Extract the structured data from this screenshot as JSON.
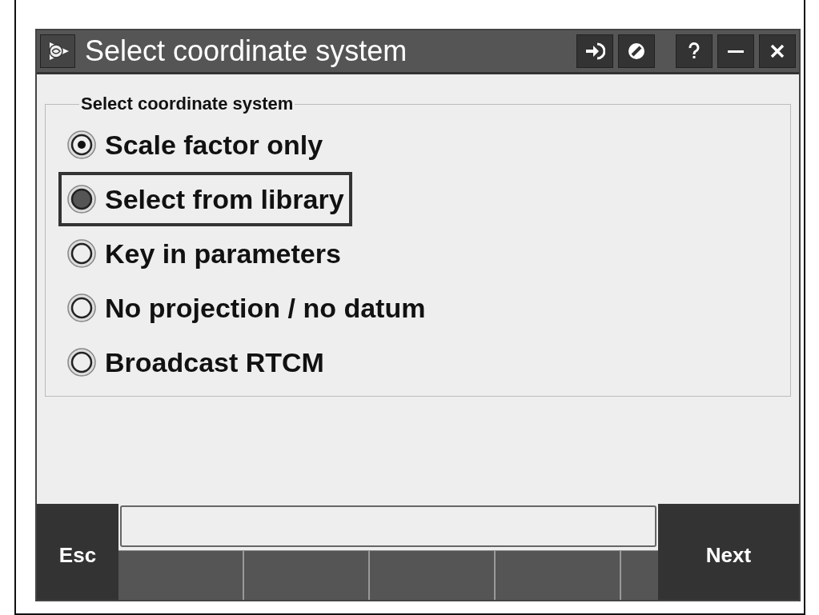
{
  "window": {
    "title": "Select coordinate system"
  },
  "group": {
    "label": "Select coordinate system",
    "options": [
      {
        "label": "Scale factor only",
        "selected": true,
        "focused": false
      },
      {
        "label": "Select from library",
        "selected": false,
        "focused": true
      },
      {
        "label": "Key in parameters",
        "selected": false,
        "focused": false
      },
      {
        "label": "No projection / no datum",
        "selected": false,
        "focused": false
      },
      {
        "label": "Broadcast RTCM",
        "selected": false,
        "focused": false
      }
    ]
  },
  "softkeys": {
    "left": "Esc",
    "right": "Next"
  }
}
